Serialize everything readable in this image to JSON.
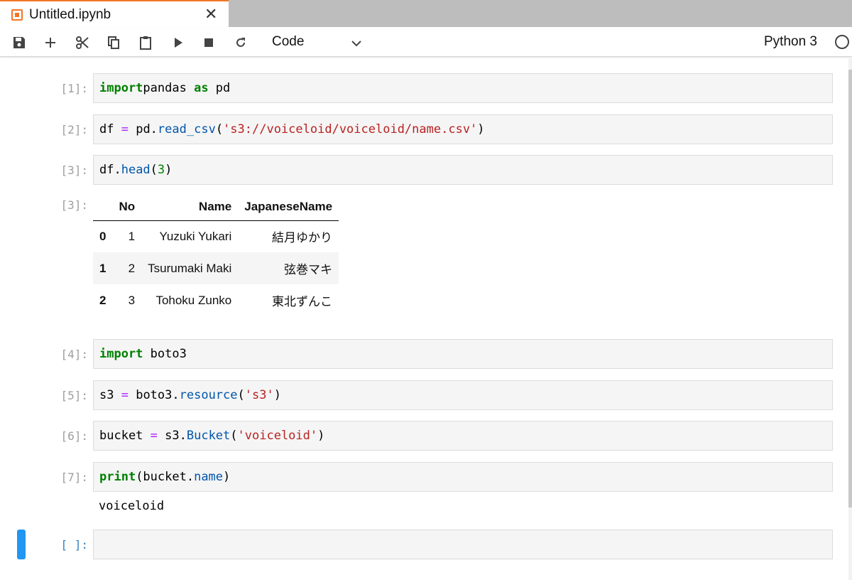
{
  "tab": {
    "title": "Untitled.ipynb",
    "close": "✕"
  },
  "toolbar": {
    "icons": [
      "save-icon",
      "add-icon",
      "cut-icon",
      "copy-icon",
      "paste-icon",
      "run-icon",
      "stop-icon",
      "restart-icon"
    ],
    "cell_type": "Code",
    "kernel": "Python 3"
  },
  "cells": [
    {
      "prompt": "[1]:",
      "code": [
        [
          "kw",
          "import"
        ],
        [
          "",
          "pandas"
        ],
        [
          "kw",
          " as"
        ],
        [
          "",
          " pd"
        ]
      ]
    },
    {
      "prompt": "[2]:",
      "code": [
        [
          "",
          "df "
        ],
        [
          "op",
          "="
        ],
        [
          "",
          " pd."
        ],
        [
          "fn",
          "read_csv"
        ],
        [
          "",
          "("
        ],
        [
          "str",
          "'s3://voiceloid/voiceloid/name.csv'"
        ],
        [
          "",
          ")"
        ]
      ]
    },
    {
      "prompt": "[3]:",
      "code": [
        [
          "",
          "df."
        ],
        [
          "fn",
          "head"
        ],
        [
          "",
          "("
        ],
        [
          "num",
          "3"
        ],
        [
          "",
          ")"
        ]
      ]
    },
    {
      "prompt": "[4]:",
      "code": [
        [
          "kw",
          "import"
        ],
        [
          "",
          " boto3"
        ]
      ]
    },
    {
      "prompt": "[5]:",
      "code": [
        [
          "",
          "s3 "
        ],
        [
          "op",
          "="
        ],
        [
          "",
          " boto3."
        ],
        [
          "fn",
          "resource"
        ],
        [
          "",
          "("
        ],
        [
          "str",
          "'s3'"
        ],
        [
          "",
          ")"
        ]
      ]
    },
    {
      "prompt": "[6]:",
      "code": [
        [
          "",
          "bucket "
        ],
        [
          "op",
          "="
        ],
        [
          "",
          " s3."
        ],
        [
          "fn",
          "Bucket"
        ],
        [
          "",
          "("
        ],
        [
          "str",
          "'voiceloid'"
        ],
        [
          "",
          ")"
        ]
      ]
    },
    {
      "prompt": "[7]:",
      "code": [
        [
          "kw",
          "print"
        ],
        [
          "",
          "(bucket."
        ],
        [
          "fn",
          "name"
        ],
        [
          "",
          ")"
        ]
      ]
    },
    {
      "prompt": "[ ]:",
      "code": []
    }
  ],
  "output3": {
    "prompt": "[3]:",
    "columns": [
      "",
      "No",
      "Name",
      "JapaneseName"
    ],
    "rows": [
      [
        "0",
        "1",
        "Yuzuki Yukari",
        "結月ゆかり"
      ],
      [
        "1",
        "2",
        "Tsurumaki Maki",
        "弦巻マキ"
      ],
      [
        "2",
        "3",
        "Tohoku Zunko",
        "東北ずんこ"
      ]
    ]
  },
  "output7": {
    "text": "voiceloid"
  },
  "colors": {
    "accent": "#f37524",
    "active_cell": "#2196f3",
    "keyword": "#008000",
    "string": "#ba2121",
    "function": "#0055aa",
    "operator": "#aa22ff"
  }
}
